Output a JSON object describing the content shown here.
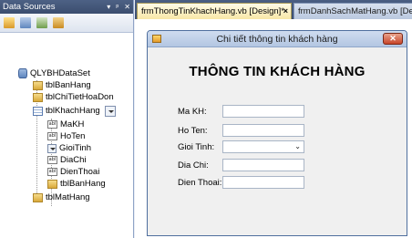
{
  "data_sources": {
    "title": "Data Sources",
    "title_buttons": [
      "▾",
      "ᵖ",
      "✕"
    ],
    "tree": {
      "dataset": "QLYBHDataSet",
      "tables_top": [
        "tblBanHang",
        "tblChiTietHoaDon"
      ],
      "khachhang": "tblKhachHang",
      "fields": [
        "MaKH",
        "HoTen",
        "GioiTinh",
        "DiaChi",
        "DienThoai"
      ],
      "nested": "tblBanHang",
      "last": "tblMatHang",
      "field_icon_text": "abl"
    }
  },
  "tabs": [
    {
      "label": "frmThongTinKhachHang.vb [Design]*",
      "close": "×"
    },
    {
      "label": "frmDanhSachMatHang.vb [Design]"
    }
  ],
  "form": {
    "caption": "Chi tiết thông tin khách hàng",
    "close": "✕",
    "heading": "THÔNG TIN KHÁCH HÀNG",
    "fields": [
      {
        "label": "Ma KH:",
        "type": "text",
        "value": ""
      },
      {
        "label": "Ho Ten:",
        "type": "text",
        "value": ""
      },
      {
        "label": "Gioi Tinh:",
        "type": "select",
        "value": ""
      },
      {
        "label": "Dia Chi:",
        "type": "text",
        "value": ""
      },
      {
        "label": "Dien Thoai:",
        "type": "text",
        "value": ""
      }
    ],
    "select_chevron": "⌄"
  }
}
